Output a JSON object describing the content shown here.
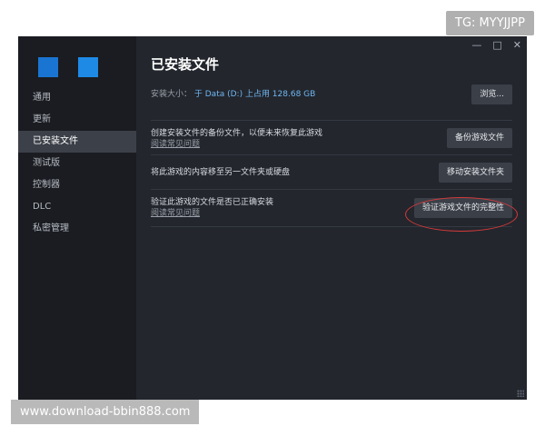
{
  "window_controls": {
    "minimize": "—",
    "maximize": "□",
    "close": "✕"
  },
  "sidebar": {
    "items": [
      {
        "label": "通用"
      },
      {
        "label": "更新"
      },
      {
        "label": "已安装文件"
      },
      {
        "label": "测试版"
      },
      {
        "label": "控制器"
      },
      {
        "label": "DLC"
      },
      {
        "label": "私密管理"
      }
    ],
    "active_index": 2
  },
  "main": {
    "title": "已安装文件",
    "install_size_label": "安装大小：",
    "install_size_value": "于 Data (D:) 上占用 128.68 GB",
    "browse_button": "浏览...",
    "rows": [
      {
        "text": "创建安装文件的备份文件，以便未来恢复此游戏",
        "link": "阅读常见问题",
        "button": "备份游戏文件"
      },
      {
        "text": "将此游戏的内容移至另一文件夹或硬盘",
        "button": "移动安装文件夹"
      },
      {
        "text": "验证此游戏的文件是否已正确安装",
        "link": "阅读常见问题",
        "button": "验证游戏文件的完整性"
      }
    ]
  },
  "watermarks": {
    "top_right": "TG: MYYJJPP",
    "bottom_left": "www.download-bbin888.com"
  },
  "colors": {
    "accent_blue": "#1a75d2",
    "drive_text": "#6fb7f2",
    "highlight_red": "#d63a3a"
  }
}
